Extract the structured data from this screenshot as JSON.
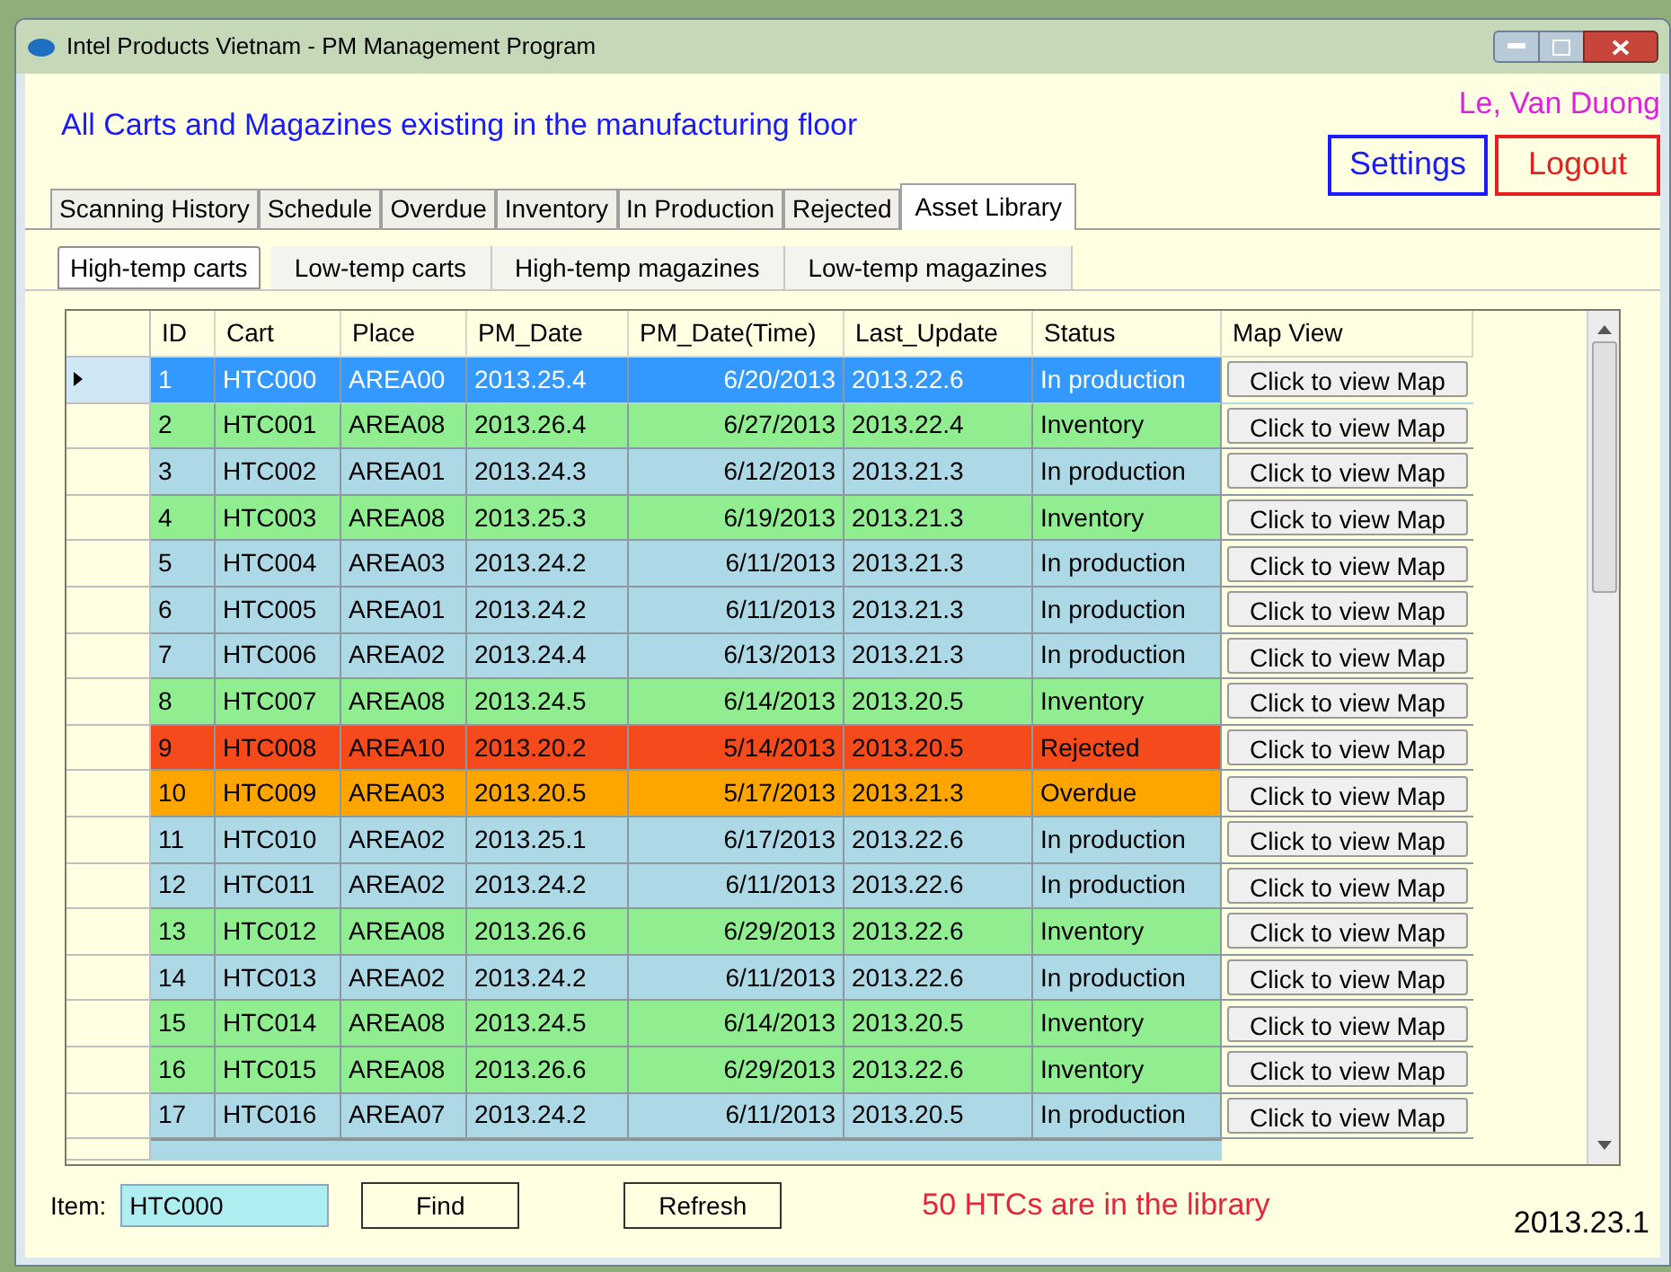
{
  "window": {
    "title": "Intel Products Vietnam - PM Management Program"
  },
  "heading": "All Carts and Magazines existing in the manufacturing floor",
  "user": "Le, Van Duong",
  "buttons": {
    "settings": "Settings",
    "logout": "Logout"
  },
  "tabs": [
    {
      "label": "Scanning History",
      "selected": false
    },
    {
      "label": "Schedule",
      "selected": false
    },
    {
      "label": "Overdue",
      "selected": false
    },
    {
      "label": "Inventory",
      "selected": false
    },
    {
      "label": "In Production",
      "selected": false
    },
    {
      "label": "Rejected",
      "selected": false
    },
    {
      "label": "Asset Library",
      "selected": true
    }
  ],
  "subtabs": [
    {
      "label": "High-temp carts",
      "selected": true
    },
    {
      "label": "Low-temp carts",
      "selected": false
    },
    {
      "label": "High-temp magazines",
      "selected": false
    },
    {
      "label": "Low-temp magazines",
      "selected": false
    }
  ],
  "table": {
    "columns": [
      "ID",
      "Cart",
      "Place",
      "PM_Date",
      "PM_Date(Time)",
      "Last_Update",
      "Status",
      "Map View"
    ],
    "rows": [
      {
        "id": "1",
        "cart": "HTC000",
        "place": "AREA00",
        "pm_date": "2013.25.4",
        "pm_time": "6/20/2013",
        "last_update": "2013.22.6",
        "status": "In production",
        "map": "Click to view Map",
        "kind": "production",
        "selected": true
      },
      {
        "id": "2",
        "cart": "HTC001",
        "place": "AREA08",
        "pm_date": "2013.26.4",
        "pm_time": "6/27/2013",
        "last_update": "2013.22.4",
        "status": "Inventory",
        "map": "Click to view Map",
        "kind": "inventory",
        "selected": false
      },
      {
        "id": "3",
        "cart": "HTC002",
        "place": "AREA01",
        "pm_date": "2013.24.3",
        "pm_time": "6/12/2013",
        "last_update": "2013.21.3",
        "status": "In production",
        "map": "Click to view Map",
        "kind": "production",
        "selected": false
      },
      {
        "id": "4",
        "cart": "HTC003",
        "place": "AREA08",
        "pm_date": "2013.25.3",
        "pm_time": "6/19/2013",
        "last_update": "2013.21.3",
        "status": "Inventory",
        "map": "Click to view Map",
        "kind": "inventory",
        "selected": false
      },
      {
        "id": "5",
        "cart": "HTC004",
        "place": "AREA03",
        "pm_date": "2013.24.2",
        "pm_time": "6/11/2013",
        "last_update": "2013.21.3",
        "status": "In production",
        "map": "Click to view Map",
        "kind": "production",
        "selected": false
      },
      {
        "id": "6",
        "cart": "HTC005",
        "place": "AREA01",
        "pm_date": "2013.24.2",
        "pm_time": "6/11/2013",
        "last_update": "2013.21.3",
        "status": "In production",
        "map": "Click to view Map",
        "kind": "production",
        "selected": false
      },
      {
        "id": "7",
        "cart": "HTC006",
        "place": "AREA02",
        "pm_date": "2013.24.4",
        "pm_time": "6/13/2013",
        "last_update": "2013.21.3",
        "status": "In production",
        "map": "Click to view Map",
        "kind": "production",
        "selected": false
      },
      {
        "id": "8",
        "cart": "HTC007",
        "place": "AREA08",
        "pm_date": "2013.24.5",
        "pm_time": "6/14/2013",
        "last_update": "2013.20.5",
        "status": "Inventory",
        "map": "Click to view Map",
        "kind": "inventory",
        "selected": false
      },
      {
        "id": "9",
        "cart": "HTC008",
        "place": "AREA10",
        "pm_date": "2013.20.2",
        "pm_time": "5/14/2013",
        "last_update": "2013.20.5",
        "status": "Rejected",
        "map": "Click to view Map",
        "kind": "rejected",
        "selected": false
      },
      {
        "id": "10",
        "cart": "HTC009",
        "place": "AREA03",
        "pm_date": "2013.20.5",
        "pm_time": "5/17/2013",
        "last_update": "2013.21.3",
        "status": "Overdue",
        "map": "Click to view Map",
        "kind": "overdue",
        "selected": false
      },
      {
        "id": "11",
        "cart": "HTC010",
        "place": "AREA02",
        "pm_date": "2013.25.1",
        "pm_time": "6/17/2013",
        "last_update": "2013.22.6",
        "status": "In production",
        "map": "Click to view Map",
        "kind": "production",
        "selected": false
      },
      {
        "id": "12",
        "cart": "HTC011",
        "place": "AREA02",
        "pm_date": "2013.24.2",
        "pm_time": "6/11/2013",
        "last_update": "2013.22.6",
        "status": "In production",
        "map": "Click to view Map",
        "kind": "production",
        "selected": false
      },
      {
        "id": "13",
        "cart": "HTC012",
        "place": "AREA08",
        "pm_date": "2013.26.6",
        "pm_time": "6/29/2013",
        "last_update": "2013.22.6",
        "status": "Inventory",
        "map": "Click to view Map",
        "kind": "inventory",
        "selected": false
      },
      {
        "id": "14",
        "cart": "HTC013",
        "place": "AREA02",
        "pm_date": "2013.24.2",
        "pm_time": "6/11/2013",
        "last_update": "2013.22.6",
        "status": "In production",
        "map": "Click to view Map",
        "kind": "production",
        "selected": false
      },
      {
        "id": "15",
        "cart": "HTC014",
        "place": "AREA08",
        "pm_date": "2013.24.5",
        "pm_time": "6/14/2013",
        "last_update": "2013.20.5",
        "status": "Inventory",
        "map": "Click to view Map",
        "kind": "inventory",
        "selected": false
      },
      {
        "id": "16",
        "cart": "HTC015",
        "place": "AREA08",
        "pm_date": "2013.26.6",
        "pm_time": "6/29/2013",
        "last_update": "2013.22.6",
        "status": "Inventory",
        "map": "Click to view Map",
        "kind": "inventory",
        "selected": false
      },
      {
        "id": "17",
        "cart": "HTC016",
        "place": "AREA07",
        "pm_date": "2013.24.2",
        "pm_time": "6/11/2013",
        "last_update": "2013.20.5",
        "status": "In production",
        "map": "Click to view Map",
        "kind": "production",
        "selected": false
      }
    ]
  },
  "search": {
    "label": "Item:",
    "value": "HTC000"
  },
  "actions": {
    "find": "Find",
    "refresh": "Refresh"
  },
  "summary": "50 HTCs are in the library",
  "version": "2013.23.1"
}
